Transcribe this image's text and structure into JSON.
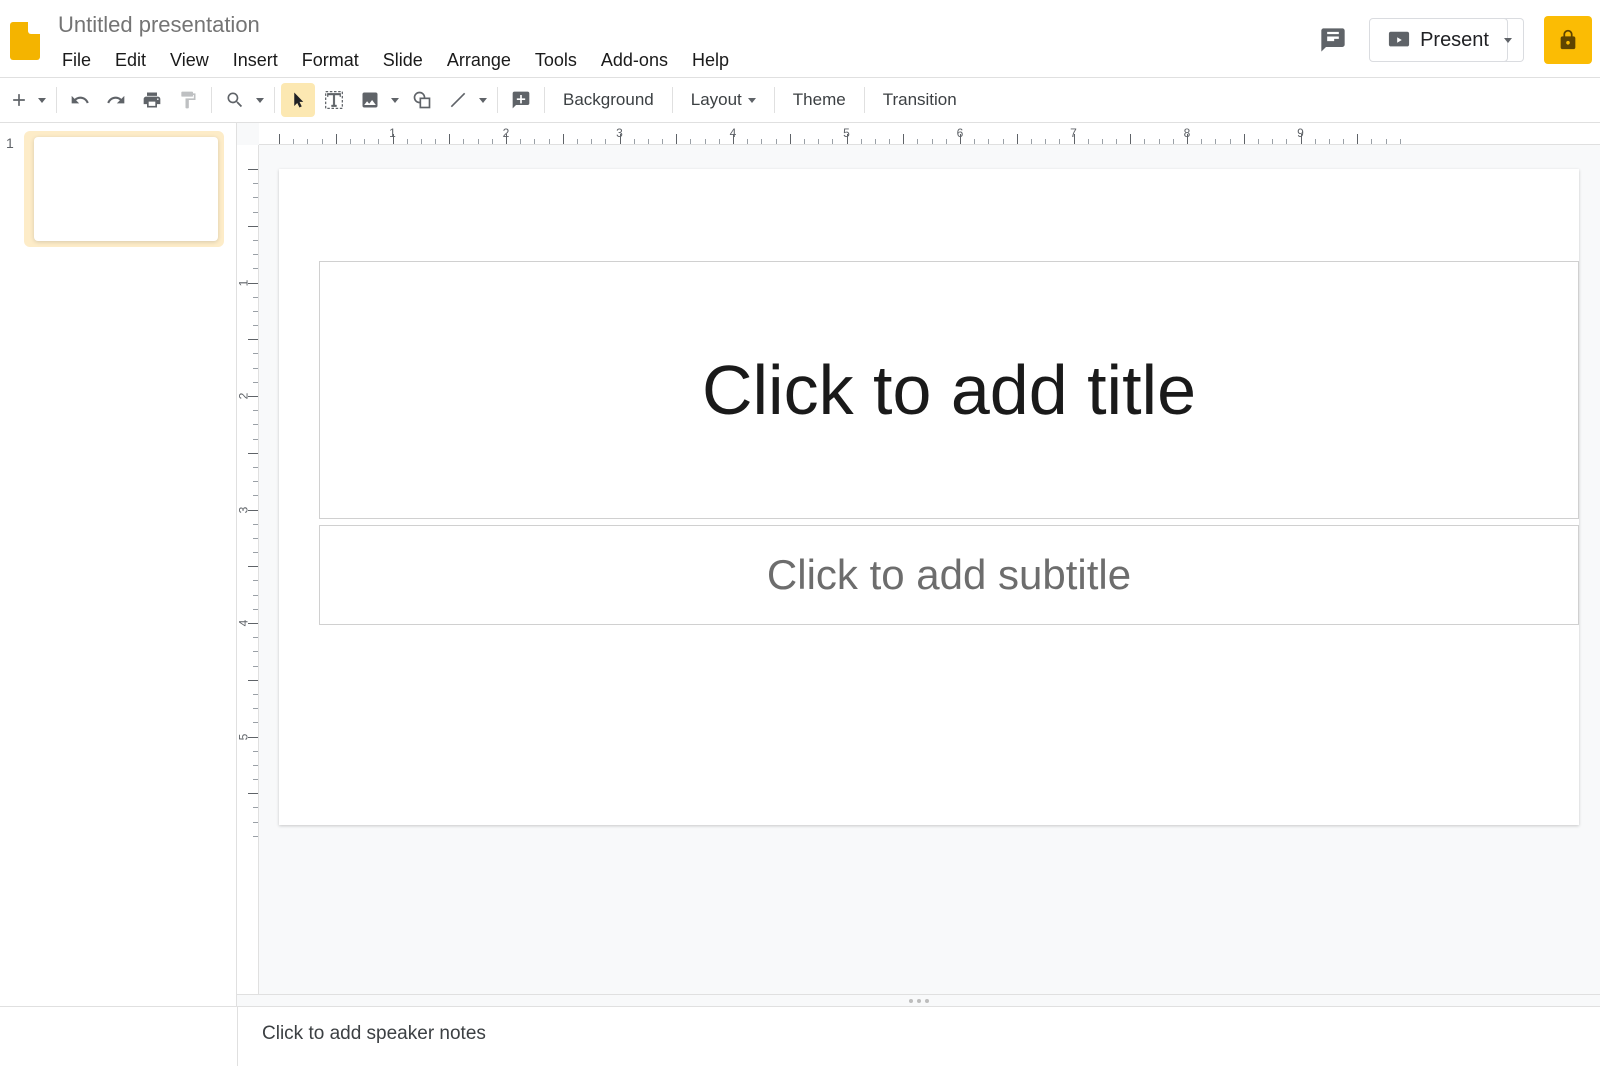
{
  "header": {
    "doc_title": "Untitled presentation",
    "present_label": "Present"
  },
  "menubar": {
    "items": [
      "File",
      "Edit",
      "View",
      "Insert",
      "Format",
      "Slide",
      "Arrange",
      "Tools",
      "Add-ons",
      "Help"
    ]
  },
  "toolbar": {
    "background": "Background",
    "layout": "Layout",
    "theme": "Theme",
    "transition": "Transition"
  },
  "ruler_h": [
    1,
    2,
    3,
    4,
    5,
    6,
    7,
    8,
    9
  ],
  "ruler_v": [
    1,
    2,
    3,
    4,
    5
  ],
  "slides": {
    "items": [
      {
        "num": "1"
      }
    ]
  },
  "canvas": {
    "title_placeholder": "Click to add title",
    "subtitle_placeholder": "Click to add subtitle"
  },
  "speaker_notes": {
    "placeholder": "Click to add speaker notes"
  }
}
